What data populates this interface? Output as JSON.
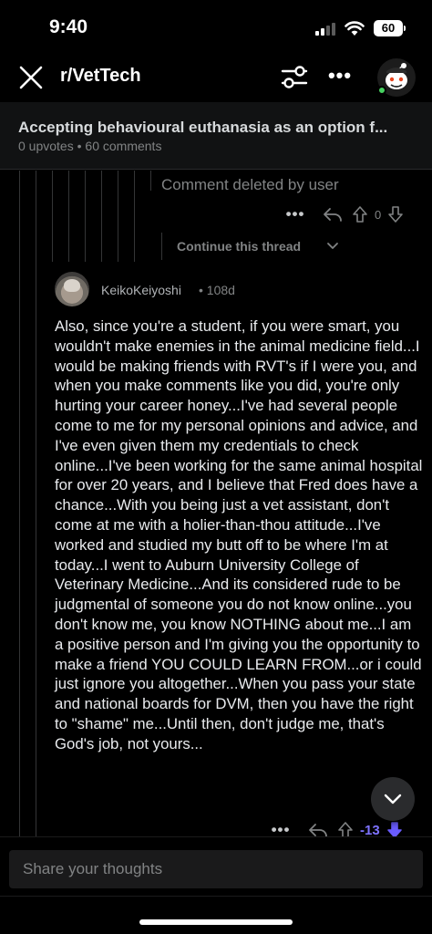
{
  "status_bar": {
    "time": "9:40",
    "battery": "60"
  },
  "header": {
    "subreddit": "r/VetTech"
  },
  "post": {
    "title": "Accepting behavioural euthanasia as an option f...",
    "upvotes": "0 upvotes",
    "separator": "•",
    "comments": "60 comments"
  },
  "deleted_comment": {
    "text": "Comment deleted by user",
    "score": "0",
    "more": "•••"
  },
  "continue_thread": {
    "label": "Continue this thread"
  },
  "comment": {
    "username": "KeikoKeiyoshi",
    "separator": "•",
    "age": "108d",
    "body": "Also, since you're a student, if you were smart, you wouldn't make enemies in the animal medicine field...I would be making friends with RVT's if I were you, and when you make comments like you did, you're only hurting your career honey...I've had several people come to me for my personal opinions and advice, and I've even given them my credentials to check online...I've been working for the same animal hospital for over 20 years, and I believe that Fred does have a chance...With you being just a vet assistant, don't come at me with a holier-than-thou attitude...I've worked and studied my butt off to be where I'm at today...I went to Auburn University College of Veterinary Medicine...And its considered rude to be judgmental of someone you do not know online...you don't know me, you know NOTHING about me...I am a positive person and I'm giving you the opportunity to make a friend YOU COULD LEARN FROM...or i could just ignore you altogether...When you pass your state and national boards for DVM, then you have the right to \"shame\" me...Until then, don't judge me, that's God's job, not yours...",
    "score": "-13",
    "more": "•••"
  },
  "composer": {
    "placeholder": "Share your thoughts"
  },
  "icons": {
    "close": "close-icon",
    "filter": "filter-icon",
    "more": "more-icon",
    "reply": "reply-icon",
    "upvote": "upvote-icon",
    "downvote": "downvote-icon",
    "scroll_down": "chevron-down-icon"
  },
  "colors": {
    "background": "#000000",
    "downvote_active": "#6a5cff",
    "online": "#46d160"
  }
}
